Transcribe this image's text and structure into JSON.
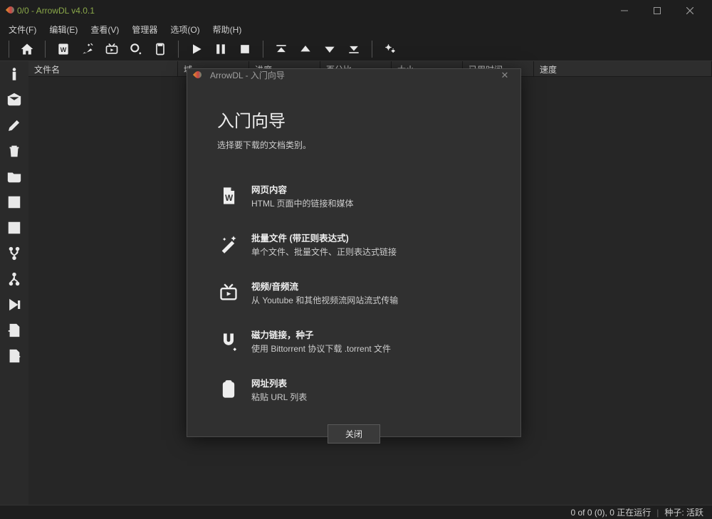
{
  "window": {
    "title": "0/0 - ArrowDL v4.0.1"
  },
  "menu": {
    "file": "文件(F)",
    "edit": "编辑(E)",
    "view": "查看(V)",
    "manager": "管理器",
    "options": "选项(O)",
    "help": "帮助(H)"
  },
  "table": {
    "columns": {
      "filename": "文件名",
      "domain": "域",
      "progress": "进度",
      "percent": "百分比",
      "size": "大小",
      "time": "已用时间",
      "speed": "速度"
    }
  },
  "statusbar": {
    "left": "0 of 0 (0), 0 正在运行",
    "right": "种子: 活跃"
  },
  "dialog": {
    "title": "ArrowDL - 入门向导",
    "heading": "入门向导",
    "subtitle": "选择要下载的文档类别。",
    "options": {
      "web": {
        "title": "网页内容",
        "desc": "HTML 页面中的链接和媒体"
      },
      "batch": {
        "title": "批量文件 (带正则表达式)",
        "desc": "单个文件、批量文件、正则表达式链接"
      },
      "stream": {
        "title": "视频/音频流",
        "desc": "从 Youtube 和其他视频流网站流式传输"
      },
      "magnet": {
        "title": "磁力链接，种子",
        "desc": "使用 Bittorrent 协议下载 .torrent 文件"
      },
      "urllist": {
        "title": "网址列表",
        "desc": "粘贴 URL 列表"
      }
    },
    "close_label": "关闭"
  }
}
